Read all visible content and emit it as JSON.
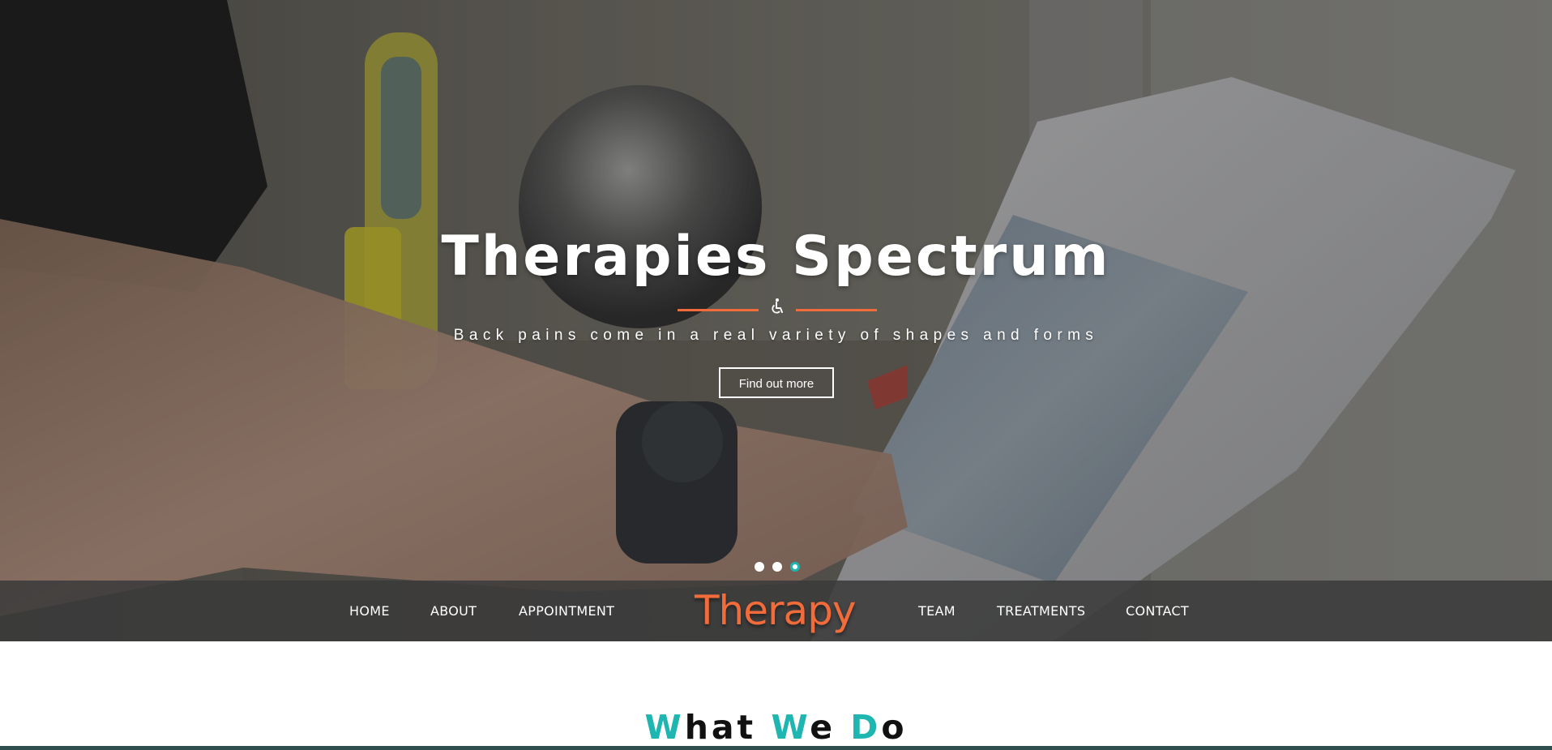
{
  "hero": {
    "title": "Therapies Spectrum",
    "subtitle": "Back pains come in a real variety of shapes and forms",
    "button_label": "Find out more",
    "divider_icon": "wheelchair-icon",
    "slides": {
      "count": 3,
      "active_index": 2
    }
  },
  "nav": {
    "logo": "Therapy",
    "items_left": [
      "HOME",
      "ABOUT",
      "APPOINTMENT"
    ],
    "items_right": [
      "TEAM",
      "TREATMENTS",
      "CONTACT"
    ]
  },
  "section": {
    "title_letters": [
      "W",
      "hat ",
      "W",
      "e ",
      "D",
      "o"
    ]
  },
  "colors": {
    "accent_orange": "#f26b3a",
    "accent_teal": "#1fb5b0",
    "nav_bg": "#3a3a3a",
    "bottom_rule": "#2f4f4f"
  }
}
